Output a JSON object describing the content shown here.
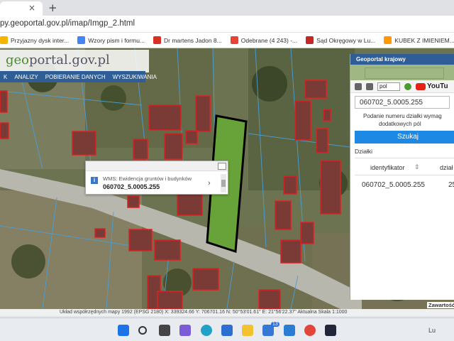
{
  "browser": {
    "tab_close": "×",
    "new_tab": "+",
    "url": "py.geoportal.gov.pl/imap/Imgp_2.html",
    "bookmarks": [
      {
        "label": "Przyjazny dysk inter...",
        "icon": "drive-icon",
        "color": "#f4b400"
      },
      {
        "label": "Wzory pism i formu...",
        "icon": "document-icon",
        "color": "#4285f4"
      },
      {
        "label": "Dr martens Jadon 8...",
        "icon": "shop-icon",
        "color": "#d93025"
      },
      {
        "label": "Odebrane (4 243) -...",
        "icon": "gmail-icon",
        "color": "#ea4335"
      },
      {
        "label": "Sąd Okręgowy w Lu...",
        "icon": "court-icon",
        "color": "#c62828"
      },
      {
        "label": "KUBEK Z IMIENIEM...",
        "icon": "amazon-icon",
        "color": "#ff9900"
      }
    ]
  },
  "geoportal": {
    "logo_prefix": "geo",
    "logo_suffix": "portal.gov.pl",
    "nav": [
      "K",
      "ANALIZY",
      "POBIERANIE DANYCH",
      "WYSZUKIWANIA"
    ]
  },
  "popup": {
    "icon_text": "i",
    "layer": "WMS: Ewidencja gruntów i budynków",
    "parcel_id": "060702_5.0005.255",
    "chevron": "›"
  },
  "panel": {
    "title": "Geoportal krajowy",
    "language": "pol",
    "youtube": "YouTu",
    "search_value": "060702_5.0005.255",
    "hint_line1": "Podanie numeru działki wymag",
    "hint_line2": "dodatkowych pól",
    "search_button": "Szukaj",
    "section_label": "Działki",
    "col1": "identyfikator",
    "sort_icon": "⇕",
    "col2": "dział",
    "row_id": "060702_5.0005.255",
    "row_val": "25"
  },
  "status": {
    "text": "Układ współrzędnych mapy 1992 (EPSG 2180)   X: 339324.66  Y: 706701.16   N: 50°53'01.61\"  E: 21°56'22.37\"   Aktualna Skala 1:1000",
    "zawart": "Zawartość"
  },
  "taskbar": {
    "badge": "13",
    "tray": "Lu"
  }
}
